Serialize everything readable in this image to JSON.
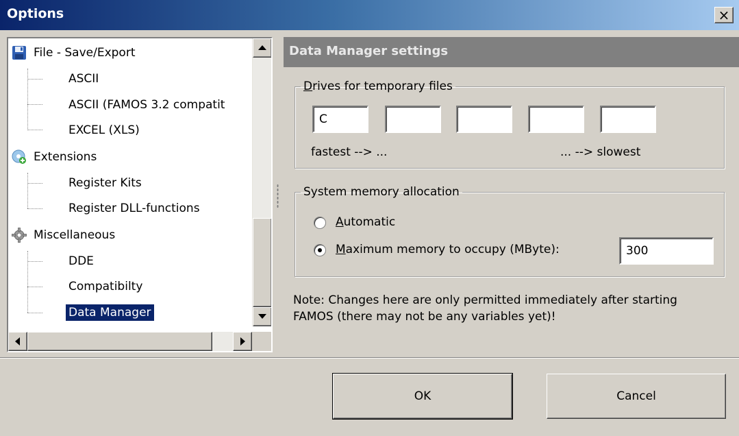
{
  "window": {
    "title": "Options",
    "close_label": "×"
  },
  "tree": {
    "items": [
      {
        "label": "File - Save/Export",
        "level": 0,
        "icon": "floppy-disk-icon"
      },
      {
        "label": "ASCII",
        "level": 1
      },
      {
        "label": "ASCII (FAMOS 3.2 compatit",
        "level": 1
      },
      {
        "label": "EXCEL (XLS)",
        "level": 1
      },
      {
        "label": "Extensions",
        "level": 0,
        "icon": "extensions-icon"
      },
      {
        "label": "Register Kits",
        "level": 1
      },
      {
        "label": "Register DLL-functions",
        "level": 1
      },
      {
        "label": "Miscellaneous",
        "level": 0,
        "icon": "gear-icon"
      },
      {
        "label": "DDE",
        "level": 1
      },
      {
        "label": "Compatibilty",
        "level": 1
      },
      {
        "label": "Data Manager",
        "level": 1,
        "selected": true
      }
    ]
  },
  "panel": {
    "header": "Data Manager settings"
  },
  "drives": {
    "legend_underlined": "D",
    "legend_rest": "rives for temporary files",
    "values": [
      "C",
      "",
      "",
      "",
      ""
    ],
    "fastest_label": "fastest --> ...",
    "slowest_label": "... --> slowest"
  },
  "memory": {
    "legend": "System memory allocation",
    "automatic_underlined": "A",
    "automatic_rest": "utomatic",
    "maximum_underlined": "M",
    "maximum_rest": "aximum memory to occupy (MByte):",
    "selected_option": "maximum",
    "max_value": "300"
  },
  "note": {
    "line1": "Note: Changes here are only permitted immediately after starting",
    "line2": "FAMOS (there may not be any variables yet)!"
  },
  "buttons": {
    "ok": "OK",
    "cancel": "Cancel"
  },
  "colors": {
    "title_start": "#0a246a",
    "title_end": "#a6caf0",
    "selection": "#0a246a",
    "face": "#d4d0c8",
    "panel_header": "#808080"
  }
}
